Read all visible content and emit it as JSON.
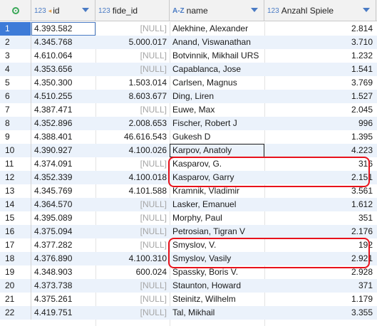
{
  "columns": {
    "id": {
      "type": "123",
      "label": "id"
    },
    "fide_id": {
      "type": "123",
      "label": "fide_id"
    },
    "name": {
      "type": "A-Z",
      "label": "name"
    },
    "anzahl": {
      "type": "123",
      "label": "Anzahl Spiele"
    }
  },
  "null_label": "[NULL]",
  "rows": [
    {
      "n": "1",
      "id": "4.393.582",
      "fide_id": "[NULL]",
      "name": "Alekhine, Alexander",
      "anzahl": "2.814"
    },
    {
      "n": "2",
      "id": "4.345.768",
      "fide_id": "5.000.017",
      "name": "Anand, Viswanathan",
      "anzahl": "3.710"
    },
    {
      "n": "3",
      "id": "4.610.064",
      "fide_id": "[NULL]",
      "name": "Botvinnik, Mikhail URS",
      "anzahl": "1.232"
    },
    {
      "n": "4",
      "id": "4.353.656",
      "fide_id": "[NULL]",
      "name": "Capablanca, Jose",
      "anzahl": "1.541"
    },
    {
      "n": "5",
      "id": "4.350.300",
      "fide_id": "1.503.014",
      "name": "Carlsen, Magnus",
      "anzahl": "3.769"
    },
    {
      "n": "6",
      "id": "4.510.255",
      "fide_id": "8.603.677",
      "name": "Ding, Liren",
      "anzahl": "1.527"
    },
    {
      "n": "7",
      "id": "4.387.471",
      "fide_id": "[NULL]",
      "name": "Euwe, Max",
      "anzahl": "2.045"
    },
    {
      "n": "8",
      "id": "4.352.896",
      "fide_id": "2.008.653",
      "name": "Fischer, Robert J",
      "anzahl": "996"
    },
    {
      "n": "9",
      "id": "4.388.401",
      "fide_id": "46.616.543",
      "name": "Gukesh D",
      "anzahl": "1.395"
    },
    {
      "n": "10",
      "id": "4.390.927",
      "fide_id": "4.100.026",
      "name": "Karpov, Anatoly",
      "anzahl": "4.223"
    },
    {
      "n": "11",
      "id": "4.374.091",
      "fide_id": "[NULL]",
      "name": "Kasparov, G.",
      "anzahl": "316"
    },
    {
      "n": "12",
      "id": "4.352.339",
      "fide_id": "4.100.018",
      "name": "Kasparov, Garry",
      "anzahl": "2.151"
    },
    {
      "n": "13",
      "id": "4.345.769",
      "fide_id": "4.101.588",
      "name": "Kramnik, Vladimir",
      "anzahl": "3.561"
    },
    {
      "n": "14",
      "id": "4.364.570",
      "fide_id": "[NULL]",
      "name": "Lasker, Emanuel",
      "anzahl": "1.612"
    },
    {
      "n": "15",
      "id": "4.395.089",
      "fide_id": "[NULL]",
      "name": "Morphy, Paul",
      "anzahl": "351"
    },
    {
      "n": "16",
      "id": "4.375.094",
      "fide_id": "[NULL]",
      "name": "Petrosian, Tigran V",
      "anzahl": "2.176"
    },
    {
      "n": "17",
      "id": "4.377.282",
      "fide_id": "[NULL]",
      "name": "Smyslov, V.",
      "anzahl": "192"
    },
    {
      "n": "18",
      "id": "4.376.890",
      "fide_id": "4.100.310",
      "name": "Smyslov, Vasily",
      "anzahl": "2.921"
    },
    {
      "n": "19",
      "id": "4.348.903",
      "fide_id": "600.024",
      "name": "Spassky, Boris V.",
      "anzahl": "2.928"
    },
    {
      "n": "20",
      "id": "4.373.738",
      "fide_id": "[NULL]",
      "name": "Staunton, Howard",
      "anzahl": "371"
    },
    {
      "n": "21",
      "id": "4.375.261",
      "fide_id": "[NULL]",
      "name": "Steinitz, Wilhelm",
      "anzahl": "1.179"
    },
    {
      "n": "22",
      "id": "4.419.751",
      "fide_id": "[NULL]",
      "name": "Tal, Mikhail",
      "anzahl": "3.355"
    }
  ],
  "colors": {
    "header_bg": "#f2f2f2",
    "alt_row_bg": "#ebf2fb",
    "selected_rownum_bg": "#3d7bd8",
    "null_text": "#a5a5a5",
    "highlight_border": "#e8121c"
  }
}
